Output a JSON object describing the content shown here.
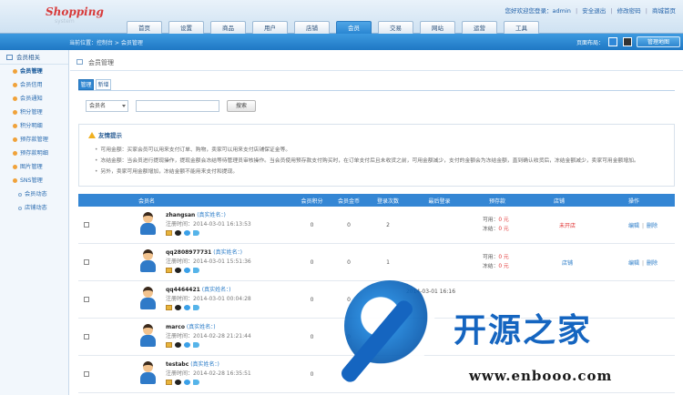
{
  "header": {
    "logo": "Shopping",
    "logo_sub": "system",
    "welcome": "您好欢迎您登录：admin",
    "links": [
      "安全退出",
      "修改密码",
      "商城首页"
    ],
    "nav": [
      "首页",
      "设置",
      "商品",
      "用户",
      "店铺",
      "会员",
      "交易",
      "网站",
      "运营",
      "工具"
    ],
    "active_nav": "会员"
  },
  "crumbbar": {
    "breadcrumb": "当前位置：控制台 > 会员管理",
    "layout_label": "页面布局：",
    "map_button": "管理地图"
  },
  "sidebar": {
    "group1": "会员相关",
    "items": [
      "会员管理",
      "会员信用",
      "会员通知",
      "积分管理",
      "积分明细",
      "预存款管理",
      "预存款明细",
      "图片管理"
    ],
    "group2": "SNS管理",
    "sub_items": [
      "会员动态",
      "店铺动态"
    ]
  },
  "page": {
    "title": "会员管理",
    "tabs": [
      "管理",
      "新增"
    ],
    "search_select": "会员名",
    "search_button": "搜索"
  },
  "tips": {
    "title": "友情提示",
    "lines": [
      "可用金额：买家会员可以用来支付订单、购物，卖家可以用来支付店铺保证金等。",
      "冻结金额：当会员进行提现操作，提现金额会冻结等待管理员审核操作。当会员使用预存款支付购买时，在订单支付后且未收货之前，可用金额减少，支付的金额会为冻结金额，直到确认收货后，冻结金额减少，卖家可用金额增加。",
      "另外，卖家可用金额增加，冻结金额不能用来支付和提现。"
    ]
  },
  "table": {
    "headers": [
      "会员名",
      "会员积分",
      "会员金币",
      "登录次数",
      "最后登录",
      "预存款",
      "店铺",
      "操作"
    ],
    "avail_label": "可用：",
    "frozen_label": "冻结：",
    "reg_label": "注册时间：",
    "rows": [
      {
        "user": "zhangsan",
        "real": "(真实姓名：)",
        "reg": "2014-03-01 16:13:53",
        "points": "0",
        "gold": "0",
        "logins": "2",
        "last": "",
        "avail": "0 元",
        "frozen": "0 元",
        "shop": "未开店",
        "ops": [
          "编辑",
          "删除"
        ]
      },
      {
        "user": "qq2808977731",
        "real": "(真实姓名：)",
        "reg": "2014-03-01 15:51:36",
        "points": "0",
        "gold": "0",
        "logins": "1",
        "last": "",
        "avail": "0 元",
        "frozen": "0 元",
        "shop": "店铺",
        "ops": [
          "编辑",
          "删除"
        ]
      },
      {
        "user": "qq4464421",
        "real": "(真实姓名：)",
        "reg": "2014-03-01 00:04:28",
        "points": "0",
        "gold": "0",
        "logins": "",
        "last": "2014-03-01 16:16",
        "avail": "",
        "frozen": "",
        "shop": "",
        "ops": []
      },
      {
        "user": "marco",
        "real": "(真实姓名：)",
        "reg": "2014-02-28 21:21:44",
        "points": "0",
        "gold": "0",
        "logins": "",
        "last": "",
        "avail": "",
        "frozen": "",
        "shop": "",
        "ops": []
      },
      {
        "user": "testabc",
        "real": "(真实姓名：)",
        "reg": "2014-02-28 16:35:51",
        "points": "0",
        "gold": "0",
        "logins": "",
        "last": "",
        "avail": "",
        "frozen": "",
        "shop": "",
        "ops": []
      }
    ]
  },
  "watermark": {
    "text": "开源之家",
    "url": "www.enbooo.com"
  }
}
